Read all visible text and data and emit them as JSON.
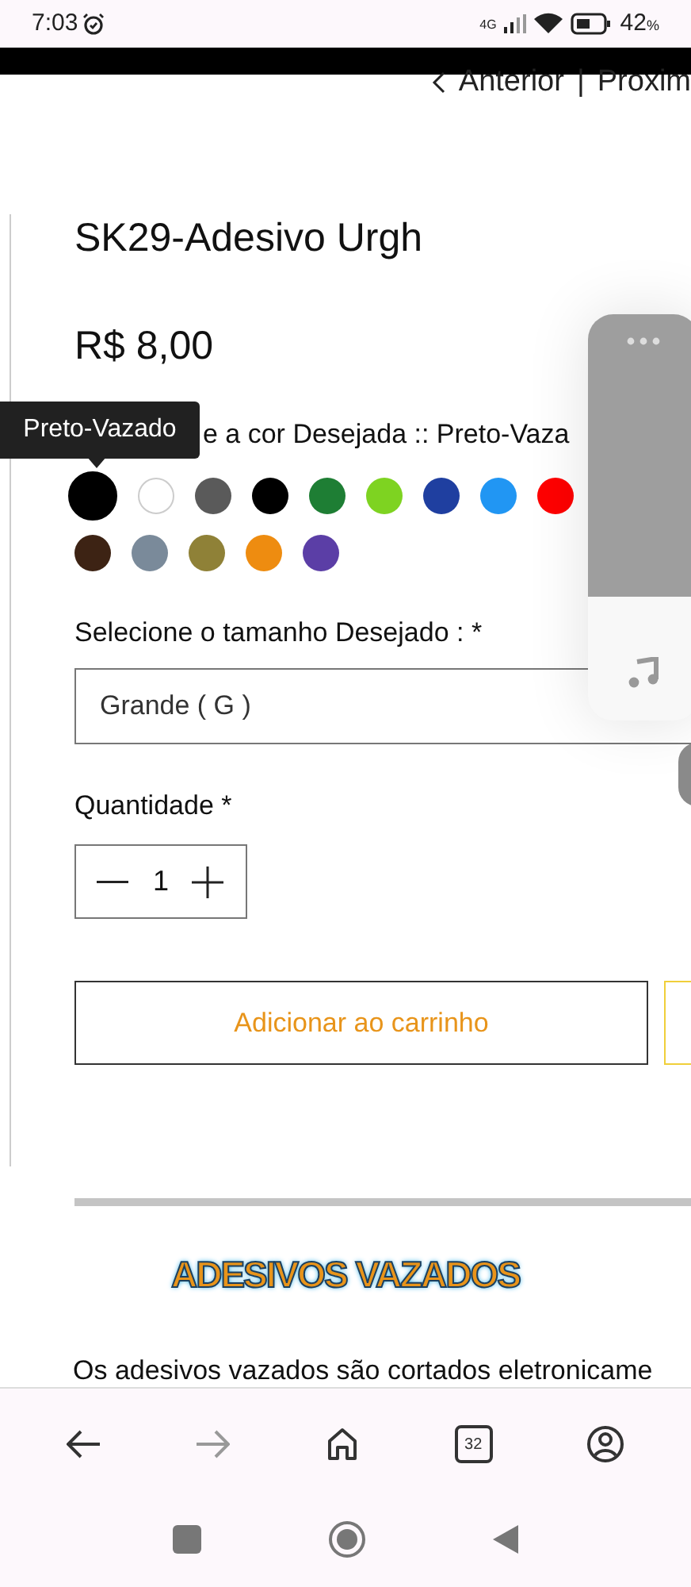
{
  "status_bar": {
    "time": "7:03",
    "network": "4G",
    "battery": "42",
    "battery_unit": "%"
  },
  "nav": {
    "prev": "Anterior",
    "separator": "|",
    "next": "Proxim"
  },
  "product": {
    "title": "SK29-Adesivo Urgh",
    "price": "R$ 8,00"
  },
  "tooltip": "Preto-Vazado",
  "color_label": "e a cor Desejada :: Preto-Vaza",
  "swatch_rows": [
    [
      {
        "color": "#000000",
        "selected": true
      },
      {
        "color": "#ffffff",
        "selected": false
      },
      {
        "color": "#5a5a5a",
        "selected": false
      },
      {
        "color": "#000000",
        "selected": false
      },
      {
        "color": "#1e7e34",
        "selected": false
      },
      {
        "color": "#7ed321",
        "selected": false
      },
      {
        "color": "#1f3fa0",
        "selected": false
      },
      {
        "color": "#2196f3",
        "selected": false
      },
      {
        "color": "#ff0000",
        "selected": false
      }
    ],
    [
      {
        "color": "#3d2314",
        "selected": false
      },
      {
        "color": "#7a8a9a",
        "selected": false
      },
      {
        "color": "#8f8137",
        "selected": false
      },
      {
        "color": "#ee8c10",
        "selected": false
      },
      {
        "color": "#5b3ea6",
        "selected": false
      }
    ]
  ],
  "size": {
    "label": "Selecione o tamanho Desejado : *",
    "value": "Grande ( G )"
  },
  "quantity": {
    "label": "Quantidade *",
    "value": "1"
  },
  "add_button": "Adicionar ao carrinho",
  "section_heading": "ADESIVOS VAZADOS",
  "description": "Os adesivos vazados são cortados eletronicame",
  "browser_bar": {
    "tab_count": "32"
  }
}
